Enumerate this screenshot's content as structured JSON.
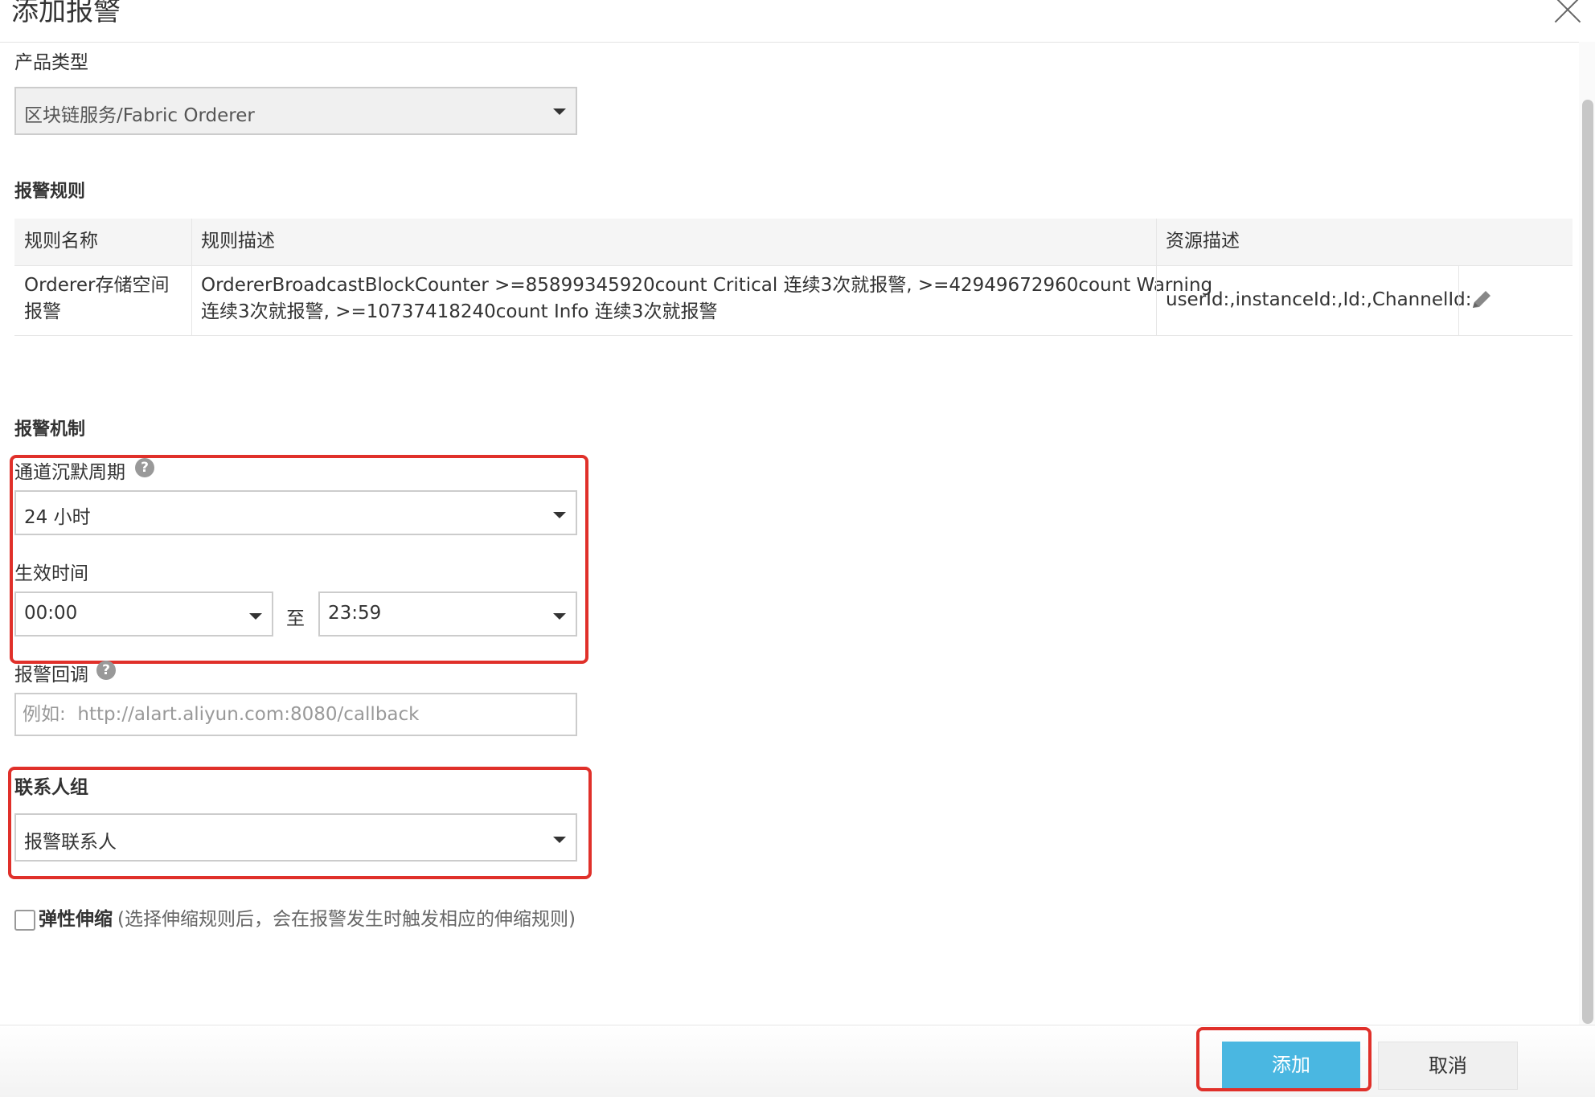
{
  "dialog": {
    "title": "添加报警"
  },
  "product": {
    "label": "产品类型",
    "value": "区块链服务/Fabric Orderer"
  },
  "rules": {
    "title": "报警规则",
    "columns": [
      "规则名称",
      "规则描述",
      "资源描述"
    ],
    "row": {
      "name_line1": "Orderer存储空间",
      "name_line2": "报警",
      "desc_line1": "OrdererBroadcastBlockCounter >=85899345920count Critical 连续3次就报警, >=42949672960count Warning",
      "desc_line2": "连续3次就报警, >=10737418240count Info 连续3次就报警",
      "resource": "userId:,instanceId:,Id:,ChannelId:"
    }
  },
  "mechanism": {
    "title": "报警机制",
    "silence_label": "通道沉默周期",
    "silence_value": "24 小时",
    "effective_label": "生效时间",
    "start_time": "00:00",
    "to_label": "至",
    "end_time": "23:59",
    "callback_label": "报警回调",
    "callback_placeholder": "例如:  http://alart.aliyun.com:8080/callback",
    "help_glyph": "?"
  },
  "contacts": {
    "label": "联系人组",
    "value": "报警联系人"
  },
  "scaling": {
    "label": "弹性伸缩",
    "hint": "(选择伸缩规则后，会在报警发生时触发相应的伸缩规则)",
    "checked": false
  },
  "footer": {
    "add_label": "添加",
    "cancel_label": "取消"
  },
  "colors": {
    "primary": "#4ab7e1",
    "highlight": "#e0302a"
  }
}
